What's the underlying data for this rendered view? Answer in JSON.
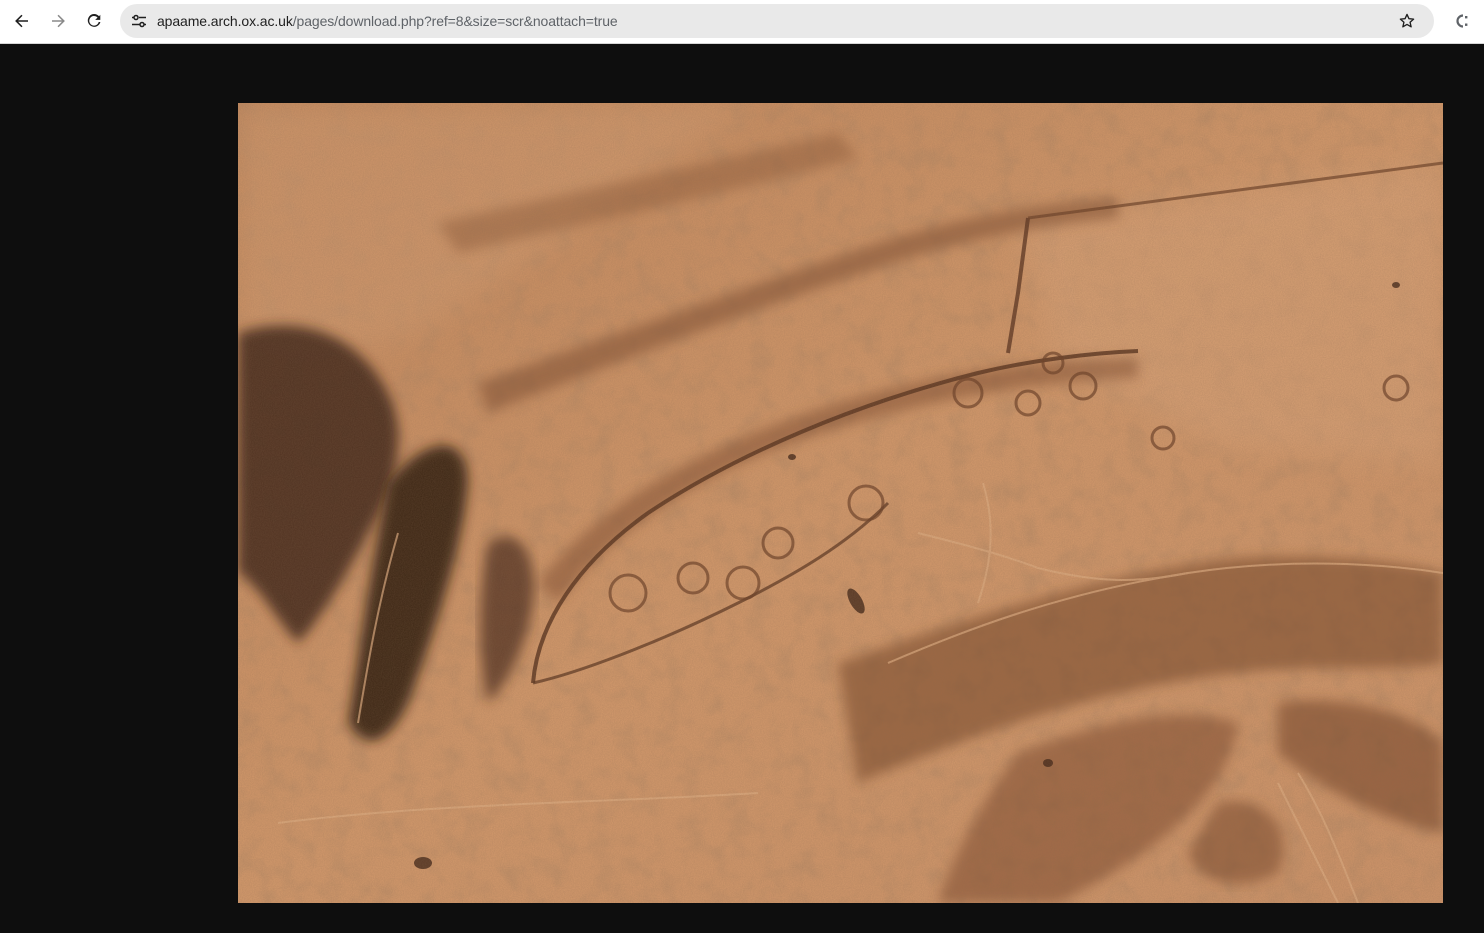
{
  "browser": {
    "back_icon": "arrow-left-icon",
    "forward_icon": "arrow-right-icon",
    "reload_icon": "reload-icon",
    "site_info_icon": "tune-icon",
    "bookmark_icon": "star-icon",
    "extension_icon": "extension-icon",
    "url_host": "apaame.arch.ox.ac.uk",
    "url_path": "/pages/download.php?ref=8&size=scr&noattach=true"
  },
  "colors": {
    "page_background": "#0e0e0e",
    "toolbar_background": "#ffffff",
    "omnibox_background": "#e9e9e9",
    "terrain_base": "#c98f63"
  }
}
